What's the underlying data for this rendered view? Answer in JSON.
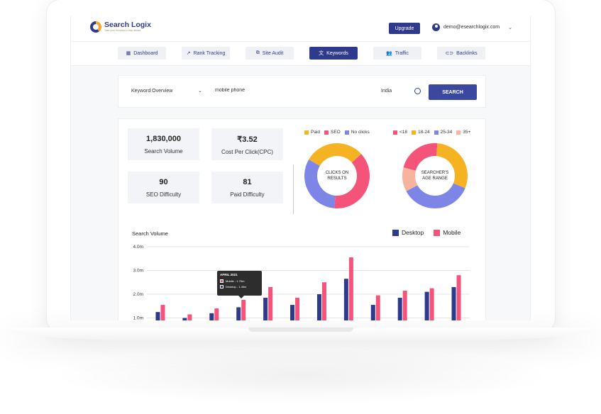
{
  "brand": {
    "name": "Search Logix",
    "tagline": "Take your business a step ahead"
  },
  "header": {
    "upgrade_label": "Upgrade",
    "user_email": "demo@esearchlogix.com",
    "user_icon": "user-circle-icon",
    "chevron_icon": "chevron-down-icon"
  },
  "nav": {
    "tabs": [
      {
        "label": "Dashboard",
        "icon": "grid-icon",
        "active": false
      },
      {
        "label": "Rank Tracking",
        "icon": "trend-icon",
        "active": false
      },
      {
        "label": "Site Audit",
        "icon": "copy-icon",
        "active": false
      },
      {
        "label": "Keywords",
        "icon": "translate-icon",
        "active": true
      },
      {
        "label": "Traffic",
        "icon": "users-icon",
        "active": false
      },
      {
        "label": "Backlinks",
        "icon": "link-icon",
        "active": false
      }
    ]
  },
  "search": {
    "type_selected": "Keyword Overview",
    "query": "mobile phone",
    "country": "India",
    "button_label": "SEARCH"
  },
  "stats": {
    "search_volume": {
      "value": "1,830,000",
      "label": "Search Volume"
    },
    "cpc": {
      "value": "₹3.52",
      "label": "Cost Per Click(CPC)"
    },
    "seo_difficulty": {
      "value": "90",
      "label": "SEO Difficulty"
    },
    "paid_difficulty": {
      "value": "81",
      "label": "Paid Difficulty"
    }
  },
  "clicks_donut": {
    "center_label_1": "CLICKS ON",
    "center_label_2": "RESULTS",
    "legend": [
      {
        "name": "Paid",
        "color": "#f5b324"
      },
      {
        "name": "SEO",
        "color": "#f4547a"
      },
      {
        "name": "No clicks",
        "color": "#7d86e6"
      }
    ],
    "values": [
      30,
      38,
      32
    ]
  },
  "age_donut": {
    "center_label_1": "SEARCHER'S",
    "center_label_2": "AGE RANGE",
    "legend": [
      {
        "name": "<18",
        "color": "#f4547a"
      },
      {
        "name": "18-24",
        "color": "#f5b324"
      },
      {
        "name": "25-34",
        "color": "#7d86e6"
      },
      {
        "name": "35+",
        "color": "#f7b39d"
      }
    ],
    "values": [
      22,
      30,
      36,
      12
    ]
  },
  "chart_data": {
    "type": "bar",
    "title": "Search Volume",
    "y_ticks": [
      "4.0m",
      "3.0m",
      "2.0m",
      "1.0m"
    ],
    "ylim": [
      0.9,
      4.0
    ],
    "series": [
      {
        "name": "Desktop",
        "color": "#2e3b8c",
        "values": [
          1.25,
          1.0,
          1.2,
          1.45,
          1.85,
          1.55,
          2.0,
          2.65,
          1.55,
          1.85,
          2.1,
          2.3
        ]
      },
      {
        "name": "Mobile",
        "color": "#f4547a",
        "values": [
          1.55,
          1.15,
          1.4,
          1.76,
          2.3,
          1.85,
          2.5,
          3.55,
          1.95,
          2.15,
          2.25,
          2.8
        ]
      }
    ],
    "tooltip": {
      "title": "APRIL 2021",
      "mobile": "Mobile - 1.76m",
      "desktop": "Desktop - 1.45m"
    }
  }
}
